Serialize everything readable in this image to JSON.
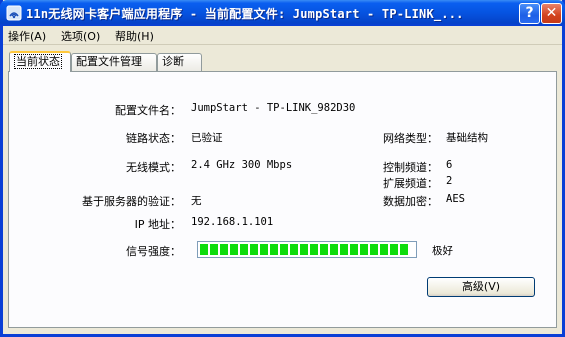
{
  "window": {
    "title": "11n无线网卡客户端应用程序 - 当前配置文件: JumpStart - TP-LINK_..."
  },
  "titlebar": {
    "help_label": "?",
    "close_label": "✕"
  },
  "menu": [
    "操作(A)",
    "选项(O)",
    "帮助(H)"
  ],
  "tabs": [
    "当前状态",
    "配置文件管理",
    "诊断"
  ],
  "status": {
    "profile_label": "配置文件名：",
    "profile_value": "JumpStart - TP-LINK_982D30",
    "link_label": "链路状态：",
    "link_value": "已验证",
    "network_type_label": "网络类型：",
    "network_type_value": "基础结构",
    "mode_label": "无线模式：",
    "mode_value": "2.4 GHz 300 Mbps",
    "control_channel_label": "控制频道：",
    "control_channel_value": "6",
    "ext_channel_label": "扩展频道：",
    "ext_channel_value": "2",
    "server_auth_label": "基于服务器的验证：",
    "server_auth_value": "无",
    "encryption_label": "数据加密：",
    "encryption_value": "AES",
    "ip_label": "IP 地址：",
    "ip_value": "192.168.1.101",
    "signal_label": "信号强度：",
    "signal_level": 1.0,
    "signal_text": "极好"
  },
  "buttons": {
    "advanced": "高级(V)"
  },
  "colors": {
    "titlebar": "#0653e0",
    "signal": "#0ddc0d",
    "tab_highlight": "#ffc83c"
  }
}
